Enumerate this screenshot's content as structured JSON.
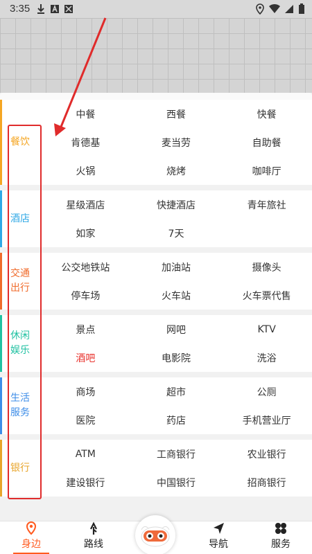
{
  "status_bar": {
    "time": "3:35",
    "left_icons": [
      "download-icon",
      "font-a-icon",
      "no-signal-icon"
    ],
    "right_icons": [
      "location-icon",
      "wifi-icon",
      "signal-icon",
      "battery-icon"
    ]
  },
  "categories": [
    {
      "label": "餐饮",
      "color": "#f5a623",
      "items": [
        "中餐",
        "西餐",
        "快餐",
        "肯德基",
        "麦当劳",
        "自助餐",
        "火锅",
        "烧烤",
        "咖啡厅"
      ]
    },
    {
      "label": "酒店",
      "color": "#2fa8e6",
      "items": [
        "星级酒店",
        "快捷酒店",
        "青年旅社",
        "如家",
        "7天"
      ]
    },
    {
      "label": "交通出行",
      "color": "#f06b2b",
      "items": [
        "公交地铁站",
        "加油站",
        "摄像头",
        "停车场",
        "火车站",
        "火车票代售"
      ]
    },
    {
      "label": "休闲娱乐",
      "color": "#21c1a2",
      "items": [
        "景点",
        "网吧",
        "KTV",
        "酒吧",
        "电影院",
        "洗浴"
      ]
    },
    {
      "label": "生活服务",
      "color": "#3d8de8",
      "items": [
        "商场",
        "超市",
        "公厕",
        "医院",
        "药店",
        "手机营业厅"
      ]
    },
    {
      "label": "银行",
      "color": "#e8a52b",
      "items": [
        "ATM",
        "工商银行",
        "农业银行",
        "建设银行",
        "中国银行",
        "招商银行"
      ]
    }
  ],
  "highlight_item": "酒吧",
  "nav": {
    "items": [
      {
        "label": "身边",
        "icon": "location-pin-icon",
        "active": true
      },
      {
        "label": "路线",
        "icon": "route-icon",
        "active": false
      },
      {
        "label": "导航",
        "icon": "navigation-arrow-icon",
        "active": false
      },
      {
        "label": "服务",
        "icon": "clover-icon",
        "active": false
      }
    ],
    "center_icon": "mascot-icon"
  },
  "colors": {
    "accent": "#ff5a1f",
    "annotation": "#e02b2b"
  }
}
